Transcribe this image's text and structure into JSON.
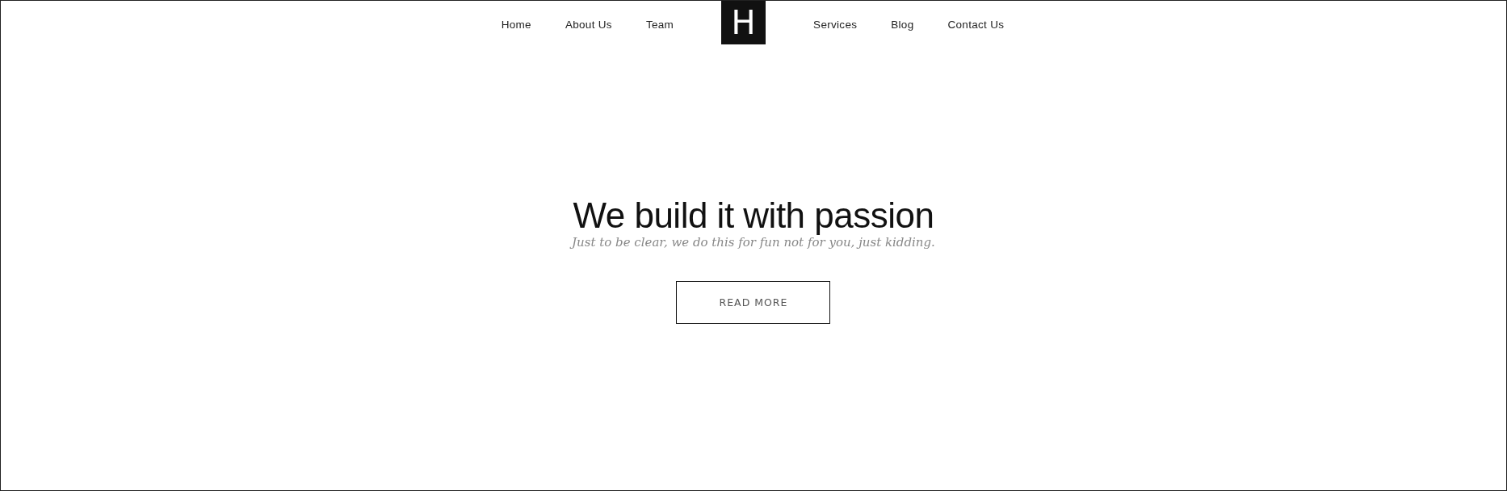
{
  "nav": {
    "left_links": [
      "Home",
      "About Us",
      "Team"
    ],
    "logo": "H",
    "right_links": [
      "Services",
      "Blog",
      "Contact Us"
    ]
  },
  "hero": {
    "title": "We build it with passion",
    "subtitle": "Just to be clear, we do this for fun not for you, just kidding.",
    "button": "READ MORE"
  }
}
